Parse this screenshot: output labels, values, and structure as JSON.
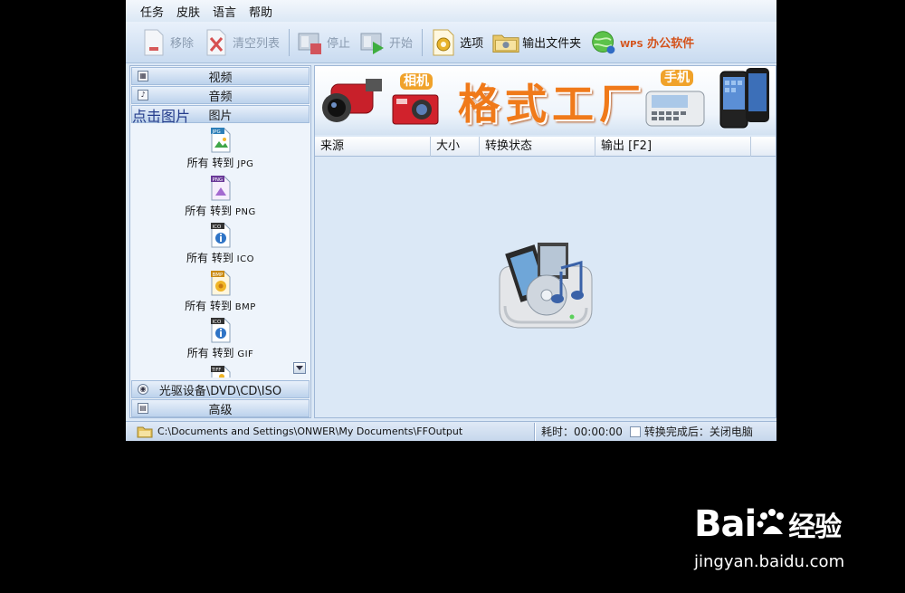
{
  "menu": [
    "任务",
    "皮肤",
    "语言",
    "帮助"
  ],
  "toolbar": {
    "remove": "移除",
    "clear_list": "清空列表",
    "stop": "停止",
    "start": "开始",
    "options": "选项",
    "output_folder": "输出文件夹",
    "wps_prefix": "WPS",
    "wps_suffix": " 办公软件"
  },
  "left_panel": {
    "categories_top": [
      "视频",
      "音频",
      "图片"
    ],
    "overlay_hint": "点击图片",
    "format_prefix": "所有 转到 ",
    "formats": [
      {
        "badge": "JPG",
        "target": "JPG"
      },
      {
        "badge": "PNG",
        "target": "PNG"
      },
      {
        "badge": "ICO",
        "target": "ICO"
      },
      {
        "badge": "BMP",
        "target": "BMP"
      },
      {
        "badge": "ICO",
        "target": "GIF"
      },
      {
        "badge": "TIFF",
        "target": ""
      }
    ],
    "categories_bottom": [
      "光驱设备\\DVD\\CD\\ISO",
      "高级"
    ]
  },
  "banner": {
    "title": "格式工厂",
    "tag_camera": "相机",
    "tag_phone": "手机"
  },
  "table": {
    "columns": [
      "来源",
      "大小",
      "转换状态",
      "输出 [F2]"
    ]
  },
  "status": {
    "path": "C:\\Documents and Settings\\ONWER\\My Documents\\FFOutput",
    "elapsed": "耗时：00:00:00",
    "after_label": "转换完成后：关闭电脑"
  },
  "watermark": {
    "brand": "Bai",
    "brand_cn": "经验",
    "url": "jingyan.baidu.com"
  },
  "colors": {
    "accent_orange": "#f07a1a",
    "wps_red": "#d4531c",
    "panel_blue": "#dbe8f6"
  }
}
